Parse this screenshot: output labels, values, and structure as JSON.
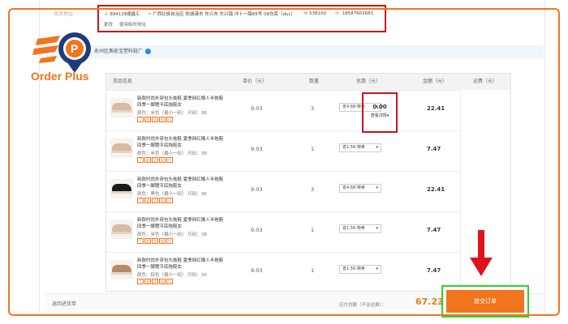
{
  "brand": {
    "name": "Order Plus",
    "accent": "#f0751e"
  },
  "address": {
    "label": "收货地址",
    "recipient": "894128德鑫汇",
    "address": "广西壮族自治区 防城港市 东兴市 东兴镇 冲卜一路65号 08仓库（duc）",
    "postcode": "538100",
    "phone": "18587603681",
    "change_link": "更改",
    "temp_link": "使用临时地址"
  },
  "store": {
    "name": "永州区奥能宝塑料鞋厂"
  },
  "table": {
    "headers": {
      "product": "货品信息",
      "unit_price": "单价（元）",
      "quantity": "数量",
      "promotion": "优惠（元）",
      "amount": "金额（元）",
      "shipping": "运费（元）"
    },
    "rows": [
      {
        "name": "新款时尚外穿包头拖鞋 夏季网红懒人半拖鞋 四季一脚蹬平底拖鞋女",
        "attrs": "颜色：米色（偏小一码） 尺码：36",
        "price": "9.03",
        "qty": "3",
        "promo": "省4.68:特卖",
        "subtotal": "22.41",
        "shoe_color": "#d9b9a0"
      },
      {
        "name": "新款时尚外穿包头拖鞋 夏季网红懒人半拖鞋 四季一脚蹬平底拖鞋女",
        "attrs": "颜色：米色（偏小一码） 尺码：39",
        "price": "9.03",
        "qty": "1",
        "promo": "省1.56:特卖",
        "subtotal": "7.47",
        "shoe_color": "#d9b9a0"
      },
      {
        "name": "新款时尚外穿包头拖鞋 夏季网红懒人半拖鞋 四季一脚蹬平底拖鞋女",
        "attrs": "颜色：黑色（偏小一码） 尺码：36",
        "price": "9.03",
        "qty": "3",
        "promo": "省4.68:特卖",
        "subtotal": "22.41",
        "shoe_color": "#1a1a1a"
      },
      {
        "name": "新款时尚外穿包头拖鞋 夏季网红懒人半拖鞋 四季一脚蹬平底拖鞋女",
        "attrs": "颜色：米色（偏小一码） 尺码：38",
        "price": "9.03",
        "qty": "1",
        "promo": "省1.56:特卖",
        "subtotal": "7.47",
        "shoe_color": "#d9b9a0"
      },
      {
        "name": "新款时尚外穿包头拖鞋 夏季网红懒人半拖鞋 四季一脚蹬平底拖鞋女",
        "attrs": "颜色：棕色（偏小一码） 尺码：39",
        "price": "9.03",
        "qty": "1",
        "promo": "省1.56:特卖",
        "subtotal": "7.47",
        "shoe_color": "#b8896a"
      }
    ],
    "tags": [
      "7",
      "退",
      "货",
      "赔",
      "付"
    ],
    "shipping": {
      "value": "0.00",
      "link": "查看详情"
    }
  },
  "footer": {
    "back_link": "返回进货单",
    "due_label": "应付总额（不含运费）：",
    "due_value": "67.23",
    "due_unit": "元",
    "submit_label": "提交订单"
  }
}
